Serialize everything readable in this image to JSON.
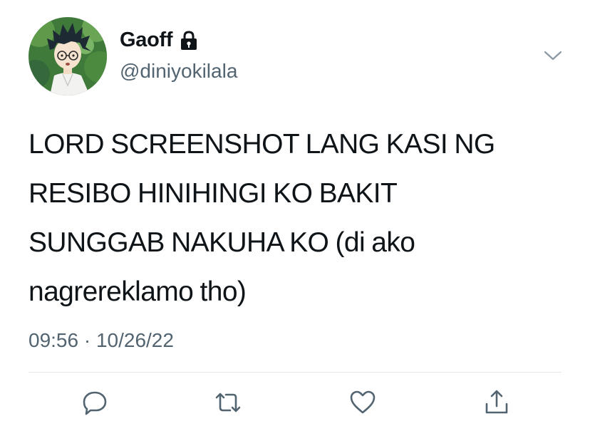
{
  "user": {
    "display_name": "Gaoff",
    "handle": "@diniyokilala",
    "protected": true,
    "avatar_icon": "anime-character-avatar"
  },
  "tweet": {
    "text": "LORD SCREENSHOT LANG KASI NG\nRESIBO HINIHINGI KO BAKIT\nSUNGGAB NAKUHA KO (di ako\nnagrereklamo tho)",
    "timestamp": "09:56 · 10/26/22"
  },
  "actions": {
    "reply_icon": "reply-icon",
    "retweet_icon": "retweet-icon",
    "like_icon": "heart-icon",
    "share_icon": "share-icon",
    "more_icon": "chevron-down-icon"
  },
  "colors": {
    "text_primary": "#0f1419",
    "text_secondary": "#536471",
    "icon_gray": "#536471",
    "divider": "#e1e8ed"
  }
}
